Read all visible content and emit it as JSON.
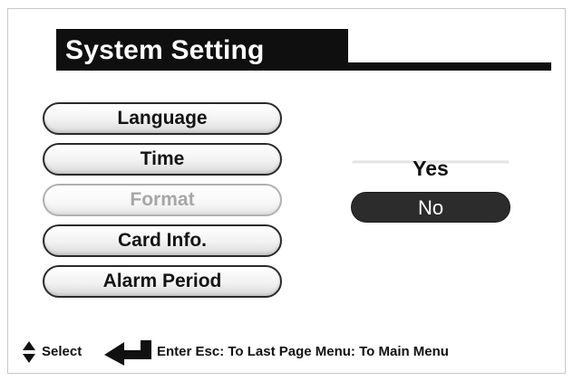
{
  "header": {
    "title": "System Setting"
  },
  "menu": {
    "items": [
      {
        "label": "Language",
        "enabled": true
      },
      {
        "label": "Time",
        "enabled": true
      },
      {
        "label": "Format",
        "enabled": false
      },
      {
        "label": "Card Info.",
        "enabled": true
      },
      {
        "label": "Alarm Period",
        "enabled": true
      }
    ]
  },
  "confirm": {
    "options": [
      {
        "label": "Yes",
        "selected": false
      },
      {
        "label": "No",
        "selected": true
      }
    ]
  },
  "help": {
    "select_label": "Select",
    "enter_label": "Enter Esc: To Last Page Menu: To Main Menu",
    "icons": [
      "up-down-arrow-icon",
      "enter-arrow-icon"
    ]
  },
  "colors": {
    "title_background": "#0f0f0f",
    "title_text": "#ffffff",
    "selected_option_background": "#2c2c2c",
    "disabled_text": "#a7a7a7"
  }
}
